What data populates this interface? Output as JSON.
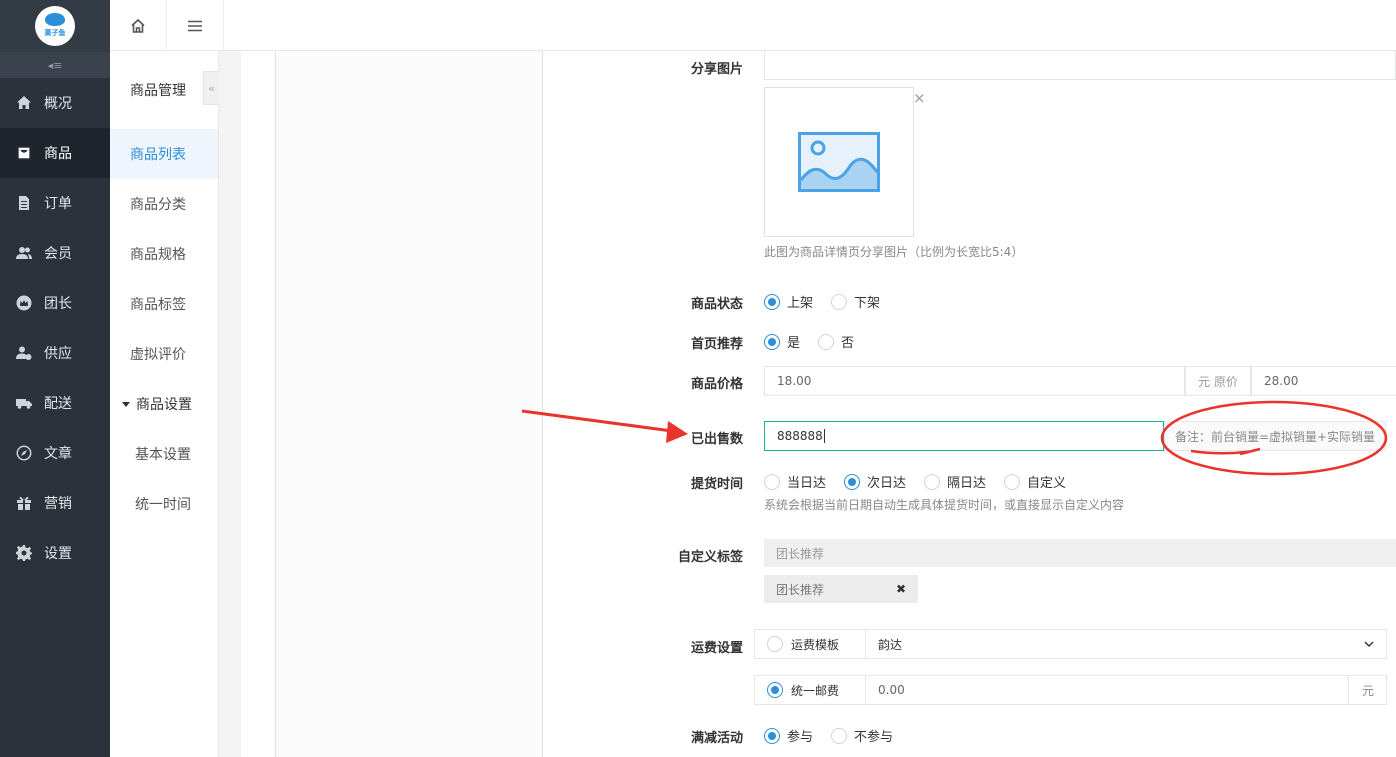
{
  "logo": {
    "text": "菓子鱼"
  },
  "sidebar": {
    "collapse_icon": "collapse-icon",
    "items": [
      {
        "label": "概况",
        "icon": "home-icon"
      },
      {
        "label": "商品",
        "icon": "bag-icon"
      },
      {
        "label": "订单",
        "icon": "document-icon"
      },
      {
        "label": "会员",
        "icon": "users-icon"
      },
      {
        "label": "团长",
        "icon": "crown-icon"
      },
      {
        "label": "供应",
        "icon": "supplier-icon"
      },
      {
        "label": "配送",
        "icon": "truck-icon"
      },
      {
        "label": "文章",
        "icon": "compass-icon"
      },
      {
        "label": "营销",
        "icon": "gift-icon"
      },
      {
        "label": "设置",
        "icon": "gear-icon"
      }
    ],
    "active": "商品"
  },
  "topbar": {
    "home_icon": "home-icon",
    "menu_icon": "hamburger-icon"
  },
  "subnav": {
    "title": "商品管理",
    "toggle": "«",
    "items": [
      "商品列表",
      "商品分类",
      "商品规格",
      "商品标签",
      "虚拟评价"
    ],
    "active": "商品列表",
    "group": {
      "label": "商品设置",
      "children": [
        "基本设置",
        "统一时间"
      ]
    }
  },
  "form": {
    "share_image": {
      "label": "分享图片",
      "close": "×",
      "help": "此图为商品详情页分享图片（比例为长宽比5:4）"
    },
    "status": {
      "label": "商品状态",
      "options": [
        "上架",
        "下架"
      ],
      "selected": "上架"
    },
    "homepage": {
      "label": "首页推荐",
      "options": [
        "是",
        "否"
      ],
      "selected": "是"
    },
    "price": {
      "label": "商品价格",
      "value": "18.00",
      "addon": "元 原价",
      "original": "28.00"
    },
    "sold": {
      "label": "已出售数",
      "value": "888888",
      "note": "备注：前台销量=虚拟销量+实际销量"
    },
    "pickup": {
      "label": "提货时间",
      "options": [
        "当日达",
        "次日达",
        "隔日达",
        "自定义"
      ],
      "selected": "次日达",
      "help": "系统会根据当前日期自动生成具体提货时间，或直接显示自定义内容"
    },
    "tags": {
      "label": "自定义标签",
      "placeholder": "团长推荐",
      "chip": "团长推荐",
      "chip_remove": "✖"
    },
    "shipping": {
      "label": "运费设置",
      "template_label": "运费模板",
      "template_value": "韵达",
      "unified_label": "统一邮费",
      "unified_value": "0.00",
      "unit": "元",
      "selected": "统一邮费"
    },
    "discount": {
      "label": "满减活动",
      "options": [
        "参与",
        "不参与"
      ],
      "selected": "参与"
    }
  },
  "annotation_colors": {
    "arrow": "#e8342c",
    "circle": "#e8342c"
  },
  "colors": {
    "accent": "#2e8ed8",
    "sidebar": "#2b323b"
  }
}
